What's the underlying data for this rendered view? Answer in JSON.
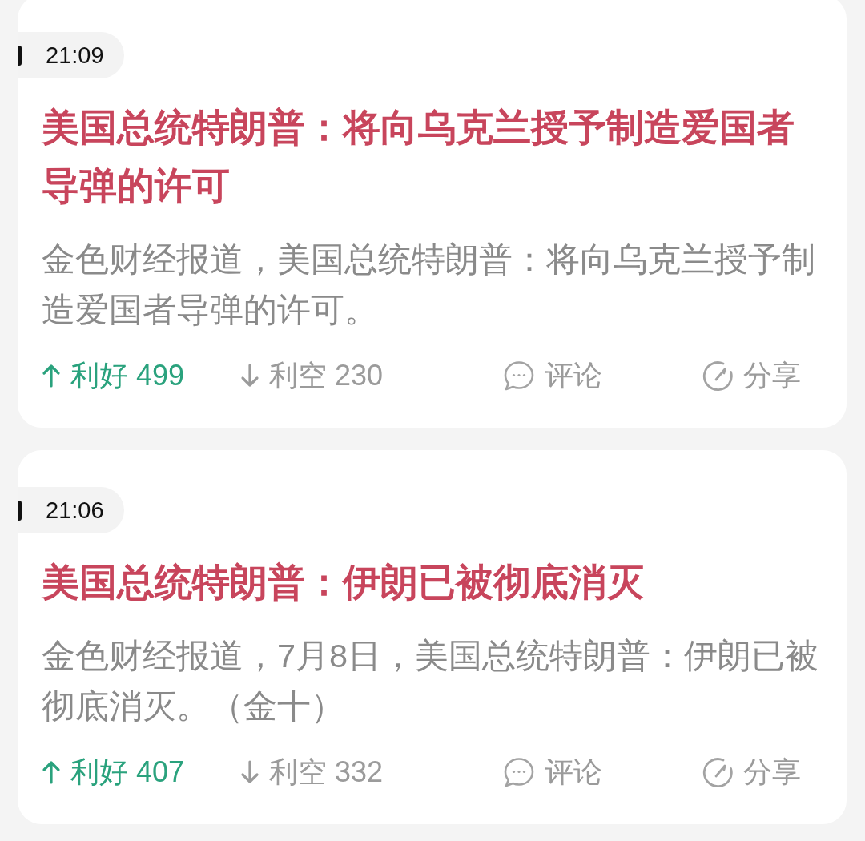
{
  "cards": [
    {
      "time": "21:09",
      "headline": "美国总统特朗普：将向乌克兰授予制造爱国者导弹的许可",
      "summary": "金色财经报道，美国总统特朗普：将向乌克兰授予制造爱国者导弹的许可。",
      "votes": [
        {
          "kind": "bullish",
          "label": "利好",
          "count": "499"
        },
        {
          "kind": "bearish",
          "label": "利空",
          "count": "230"
        }
      ],
      "actions": [
        {
          "kind": "comment",
          "label": "评论"
        },
        {
          "kind": "share",
          "label": "分享"
        }
      ]
    },
    {
      "time": "21:06",
      "headline": "美国总统特朗普：伊朗已被彻底消灭",
      "summary": "金色财经报道，7月8日，美国总统特朗普：伊朗已被彻底消灭。（金十）",
      "votes": [
        {
          "kind": "bullish",
          "label": "利好",
          "count": "407"
        },
        {
          "kind": "bearish",
          "label": "利空",
          "count": "332"
        }
      ],
      "actions": [
        {
          "kind": "comment",
          "label": "评论"
        },
        {
          "kind": "share",
          "label": "分享"
        }
      ]
    }
  ]
}
